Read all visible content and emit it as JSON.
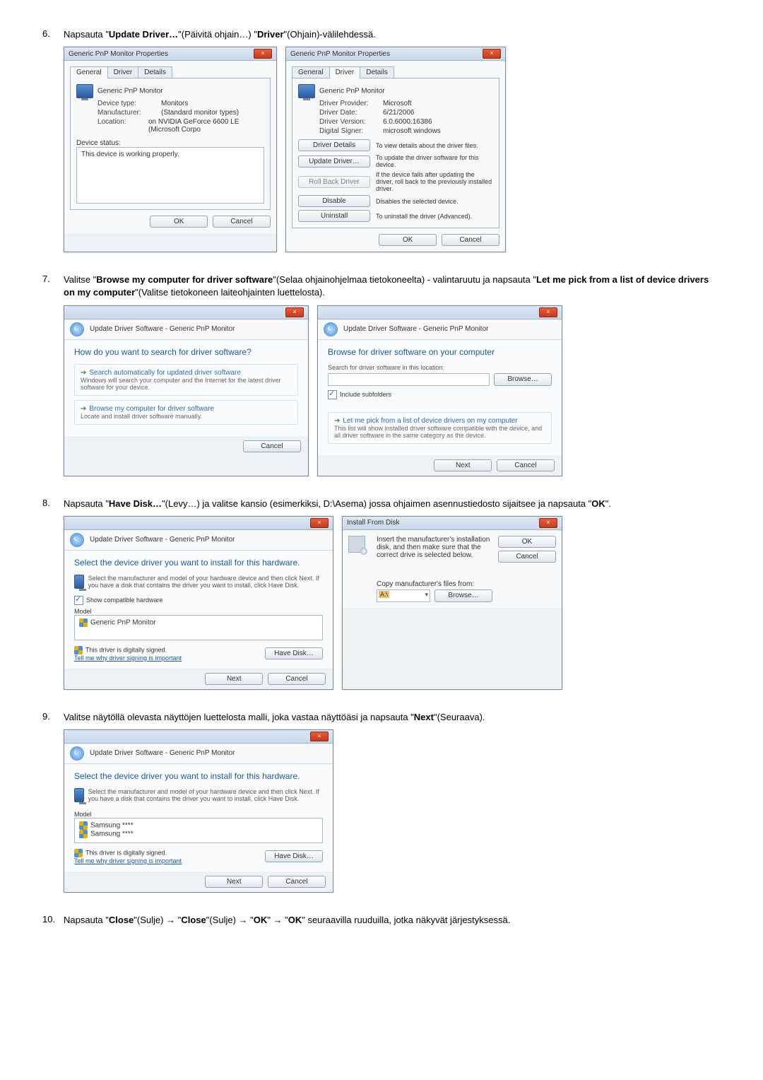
{
  "steps": {
    "s6": {
      "num": "6.",
      "text_a": "Napsauta \"",
      "b1": "Update Driver…",
      "text_b": "\"(Päivitä ohjain…) \"",
      "b2": "Driver",
      "text_c": "\"(Ohjain)-välilehdessä."
    },
    "s7": {
      "num": "7.",
      "text_a": "Valitse \"",
      "b1": "Browse my computer for driver software",
      "text_b": "\"(Selaa ohjainohjelmaa tietokoneelta) - valintaruutu ja napsauta \"",
      "b2": "Let me pick from a list of device drivers on my computer",
      "text_c": "\"(Valitse tietokoneen laiteohjainten luettelosta)."
    },
    "s8": {
      "num": "8.",
      "text_a": "Napsauta \"",
      "b1": "Have Disk…",
      "text_b": "\"(Levy…) ja valitse kansio (esimerkiksi, D:\\Asema) jossa ohjaimen asennustiedosto sijaitsee ja napsauta \"",
      "b2": "OK",
      "text_c": "\"."
    },
    "s9": {
      "num": "9.",
      "text_a": "Valitse näytöllä olevasta näyttöjen luettelosta malli, joka vastaa näyttöäsi ja napsauta \"",
      "b1": "Next",
      "text_b": "\"(Seuraava)."
    },
    "s10": {
      "num": "10.",
      "text_a": "Napsauta \"",
      "b1": "Close",
      "text_b": "\"(Sulje) → \"",
      "b2": "Close",
      "text_c": "\"(Sulje) → \"",
      "b3": "OK",
      "text_d": "\" → \"",
      "b4": "OK",
      "text_e": "\" seuraavilla ruuduilla, jotka näkyvät järjestyksessä."
    }
  },
  "dlg6a": {
    "title": "Generic PnP Monitor Properties",
    "tabs": {
      "general": "General",
      "driver": "Driver",
      "details": "Details"
    },
    "name": "Generic PnP Monitor",
    "device_type_k": "Device type:",
    "device_type_v": "Monitors",
    "manufacturer_k": "Manufacturer:",
    "manufacturer_v": "(Standard monitor types)",
    "location_k": "Location:",
    "location_v": "on NVIDIA GeForce 6600 LE (Microsoft Corpo",
    "status_label": "Device status:",
    "status_text": "This device is working properly.",
    "ok": "OK",
    "cancel": "Cancel"
  },
  "dlg6b": {
    "title": "Generic PnP Monitor Properties",
    "tabs": {
      "general": "General",
      "driver": "Driver",
      "details": "Details"
    },
    "name": "Generic PnP Monitor",
    "provider_k": "Driver Provider:",
    "provider_v": "Microsoft",
    "date_k": "Driver Date:",
    "date_v": "6/21/2006",
    "version_k": "Driver Version:",
    "version_v": "6.0.6000.16386",
    "signer_k": "Digital Signer:",
    "signer_v": "microsoft windows",
    "btn_details": "Driver Details",
    "btn_details_d": "To view details about the driver files.",
    "btn_update": "Update Driver…",
    "btn_update_d": "To update the driver software for this device.",
    "btn_roll": "Roll Back Driver",
    "btn_roll_d": "If the device fails after updating the driver, roll back to the previously installed driver.",
    "btn_disable": "Disable",
    "btn_disable_d": "Disables the selected device.",
    "btn_uninstall": "Uninstall",
    "btn_uninstall_d": "To uninstall the driver (Advanced).",
    "ok": "OK",
    "cancel": "Cancel"
  },
  "dlg7a": {
    "title": "Update Driver Software - Generic PnP Monitor",
    "heading": "How do you want to search for driver software?",
    "opt1_t": "Search automatically for updated driver software",
    "opt1_d": "Windows will search your computer and the Internet for the latest driver software for your device.",
    "opt2_t": "Browse my computer for driver software",
    "opt2_d": "Locate and install driver software manually.",
    "cancel": "Cancel"
  },
  "dlg7b": {
    "title": "Update Driver Software - Generic PnP Monitor",
    "heading": "Browse for driver software on your computer",
    "search_label": "Search for driver software in this location:",
    "browse": "Browse…",
    "include": "Include subfolders",
    "opt_t": "Let me pick from a list of device drivers on my computer",
    "opt_d": "This list will show installed driver software compatible with the device, and all driver software in the same category as the device.",
    "next": "Next",
    "cancel": "Cancel"
  },
  "dlg8a": {
    "title": "Update Driver Software - Generic PnP Monitor",
    "heading": "Select the device driver you want to install for this hardware.",
    "desc": "Select the manufacturer and model of your hardware device and then click Next. If you have a disk that contains the driver you want to install, click Have Disk.",
    "compat": "Show compatible hardware",
    "model_label": "Model",
    "model_item": "Generic PnP Monitor",
    "signed": "This driver is digitally signed.",
    "tell": "Tell me why driver signing is important",
    "have_disk": "Have Disk…",
    "next": "Next",
    "cancel": "Cancel"
  },
  "dlg8b": {
    "title": "Install From Disk",
    "msg": "Insert the manufacturer's installation disk, and then make sure that the correct drive is selected below.",
    "ok": "OK",
    "cancel": "Cancel",
    "copy_label": "Copy manufacturer's files from:",
    "path": "A:\\",
    "browse": "Browse…"
  },
  "dlg9": {
    "title": "Update Driver Software - Generic PnP Monitor",
    "heading": "Select the device driver you want to install for this hardware.",
    "desc": "Select the manufacturer and model of your hardware device and then click Next. If you have a disk that contains the driver you want to install, click Have Disk.",
    "model_label": "Model",
    "model_item1": "Samsung ****",
    "model_item2": "Samsung ****",
    "signed": "This driver is digitally signed.",
    "tell": "Tell me why driver signing is important",
    "have_disk": "Have Disk…",
    "next": "Next",
    "cancel": "Cancel"
  }
}
